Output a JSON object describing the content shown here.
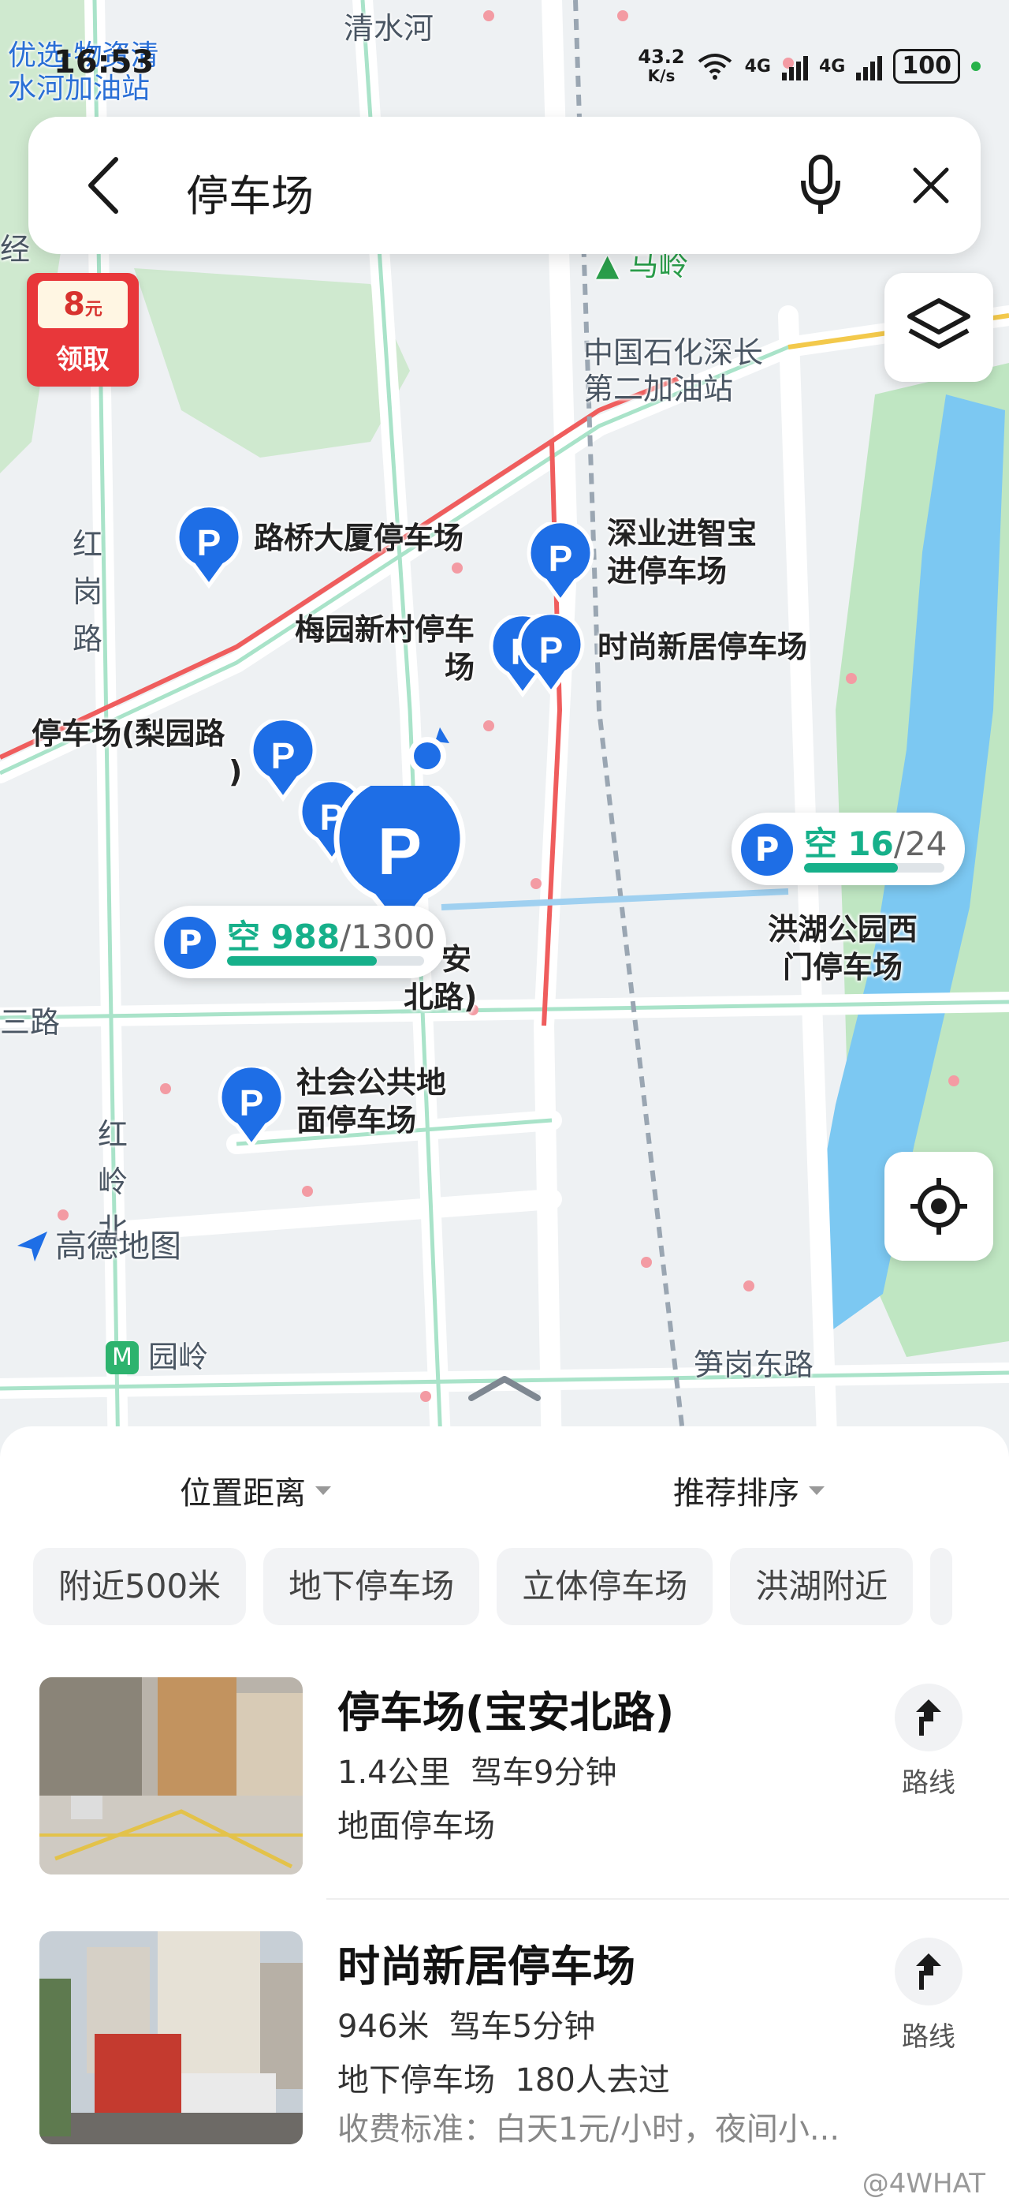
{
  "status_bar": {
    "time": "16:53",
    "net_speed_value": "43.2",
    "net_speed_unit": "K/s",
    "sim1": "4G",
    "sim2": "4G",
    "battery": "100"
  },
  "search": {
    "query": "停车场"
  },
  "coupon": {
    "amount": "8",
    "unit": "元",
    "label": "领取"
  },
  "map": {
    "logo_text": "高德地图",
    "place_labels": [
      "优选·物资清",
      "水河加油站",
      "清水河",
      "马岭",
      "中国石化深长",
      "第二加油站",
      "红",
      "岗",
      "路",
      "红",
      "岭",
      "北",
      "园岭",
      "笋岗东路",
      "三路",
      "经"
    ],
    "parking_pins": [
      {
        "label": "路桥大厦停车场"
      },
      {
        "label": "深业进智宝"
      },
      {
        "label": "进停车场"
      },
      {
        "label": "梅园新村停车"
      },
      {
        "label": "场"
      },
      {
        "label": "时尚新居停车场"
      },
      {
        "label": "停车场(梨园路"
      },
      {
        "label": ")"
      },
      {
        "label": "社会公共地"
      },
      {
        "label": "面停车场"
      },
      {
        "label": "洪湖公园西"
      },
      {
        "label": "门停车场"
      },
      {
        "label": "安"
      },
      {
        "label": "北路)"
      }
    ],
    "availability": [
      {
        "empty_label": "空",
        "free": "988",
        "total": "/1300",
        "ratio": 0.76
      },
      {
        "empty_label": "空",
        "free": "16",
        "total": "/24",
        "ratio": 0.67
      }
    ]
  },
  "sort": {
    "distance": "位置距离",
    "order": "推荐排序"
  },
  "filters": [
    "附近500米",
    "地下停车场",
    "立体停车场",
    "洪湖附近"
  ],
  "results": [
    {
      "title": "停车场(宝安北路)",
      "distance": "1.4公里",
      "drive": "驾车9分钟",
      "type": "地面停车场",
      "visited": "",
      "fee": "",
      "route_label": "路线"
    },
    {
      "title": "时尚新居停车场",
      "distance": "946米",
      "drive": "驾车5分钟",
      "type": "地下停车场",
      "visited": "180人去过",
      "fee": "收费标准：白天1元/小时，夜间小...",
      "route_label": "路线"
    }
  ],
  "watermark": "@4WHAT",
  "colors": {
    "pin_blue": "#1e6ee6",
    "accent_green": "#16b08a",
    "coupon_red": "#e8373a",
    "lake_blue": "#7cc8f2",
    "park_green": "#bfe6c2"
  }
}
